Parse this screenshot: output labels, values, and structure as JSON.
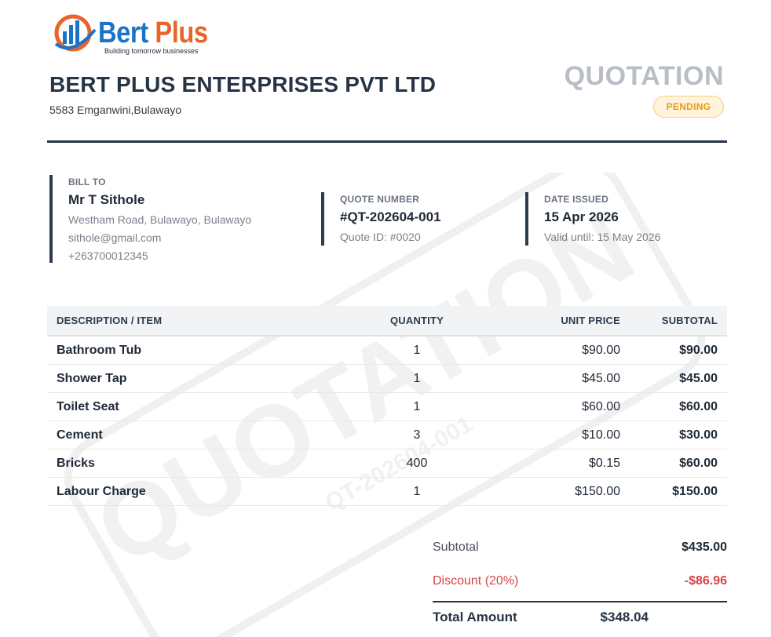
{
  "company": {
    "logo_name_primary": "Bert",
    "logo_name_secondary": "Plus",
    "logo_tagline": "Building tomorrow businesses",
    "name": "BERT PLUS ENTERPRISES PVT LTD",
    "address": "5583 Emganwini,Bulawayo"
  },
  "document": {
    "title": "QUOTATION",
    "status": "PENDING",
    "watermark_text": "QUOTATION",
    "watermark_subtext": "QT-202604-001"
  },
  "bill_to": {
    "label": "BILL TO",
    "name": "Mr T Sithole",
    "address": "Westham Road, Bulawayo, Bulawayo",
    "email": "sithole@gmail.com",
    "phone": "+263700012345"
  },
  "quote": {
    "label": "QUOTE NUMBER",
    "number": "#QT-202604-001",
    "id_text": "Quote ID: #0020"
  },
  "date": {
    "label": "DATE ISSUED",
    "issued": "15 Apr 2026",
    "valid_until": "Valid until: 15 May 2026"
  },
  "table": {
    "headers": {
      "description": "DESCRIPTION / ITEM",
      "quantity": "QUANTITY",
      "unit_price": "UNIT PRICE",
      "subtotal": "SUBTOTAL"
    },
    "rows": [
      {
        "description": "Bathroom Tub",
        "quantity": "1",
        "unit_price": "$90.00",
        "subtotal": "$90.00"
      },
      {
        "description": "Shower Tap",
        "quantity": "1",
        "unit_price": "$45.00",
        "subtotal": "$45.00"
      },
      {
        "description": "Toilet Seat",
        "quantity": "1",
        "unit_price": "$60.00",
        "subtotal": "$60.00"
      },
      {
        "description": "Cement",
        "quantity": "3",
        "unit_price": "$10.00",
        "subtotal": "$30.00"
      },
      {
        "description": "Bricks",
        "quantity": "400",
        "unit_price": "$0.15",
        "subtotal": "$60.00"
      },
      {
        "description": "Labour Charge",
        "quantity": "1",
        "unit_price": "$150.00",
        "subtotal": "$150.00"
      }
    ]
  },
  "totals": {
    "subtotal_label": "Subtotal",
    "subtotal_value": "$435.00",
    "discount_label": "Discount (20%)",
    "discount_value": "-$86.96",
    "total_label": "Total Amount",
    "total_value": "$348.04"
  },
  "colors": {
    "brand_blue": "#1a73c7",
    "brand_orange": "#e8642a",
    "navy": "#263445",
    "discount_red": "#d64545",
    "pending_amber": "#e69a14"
  }
}
